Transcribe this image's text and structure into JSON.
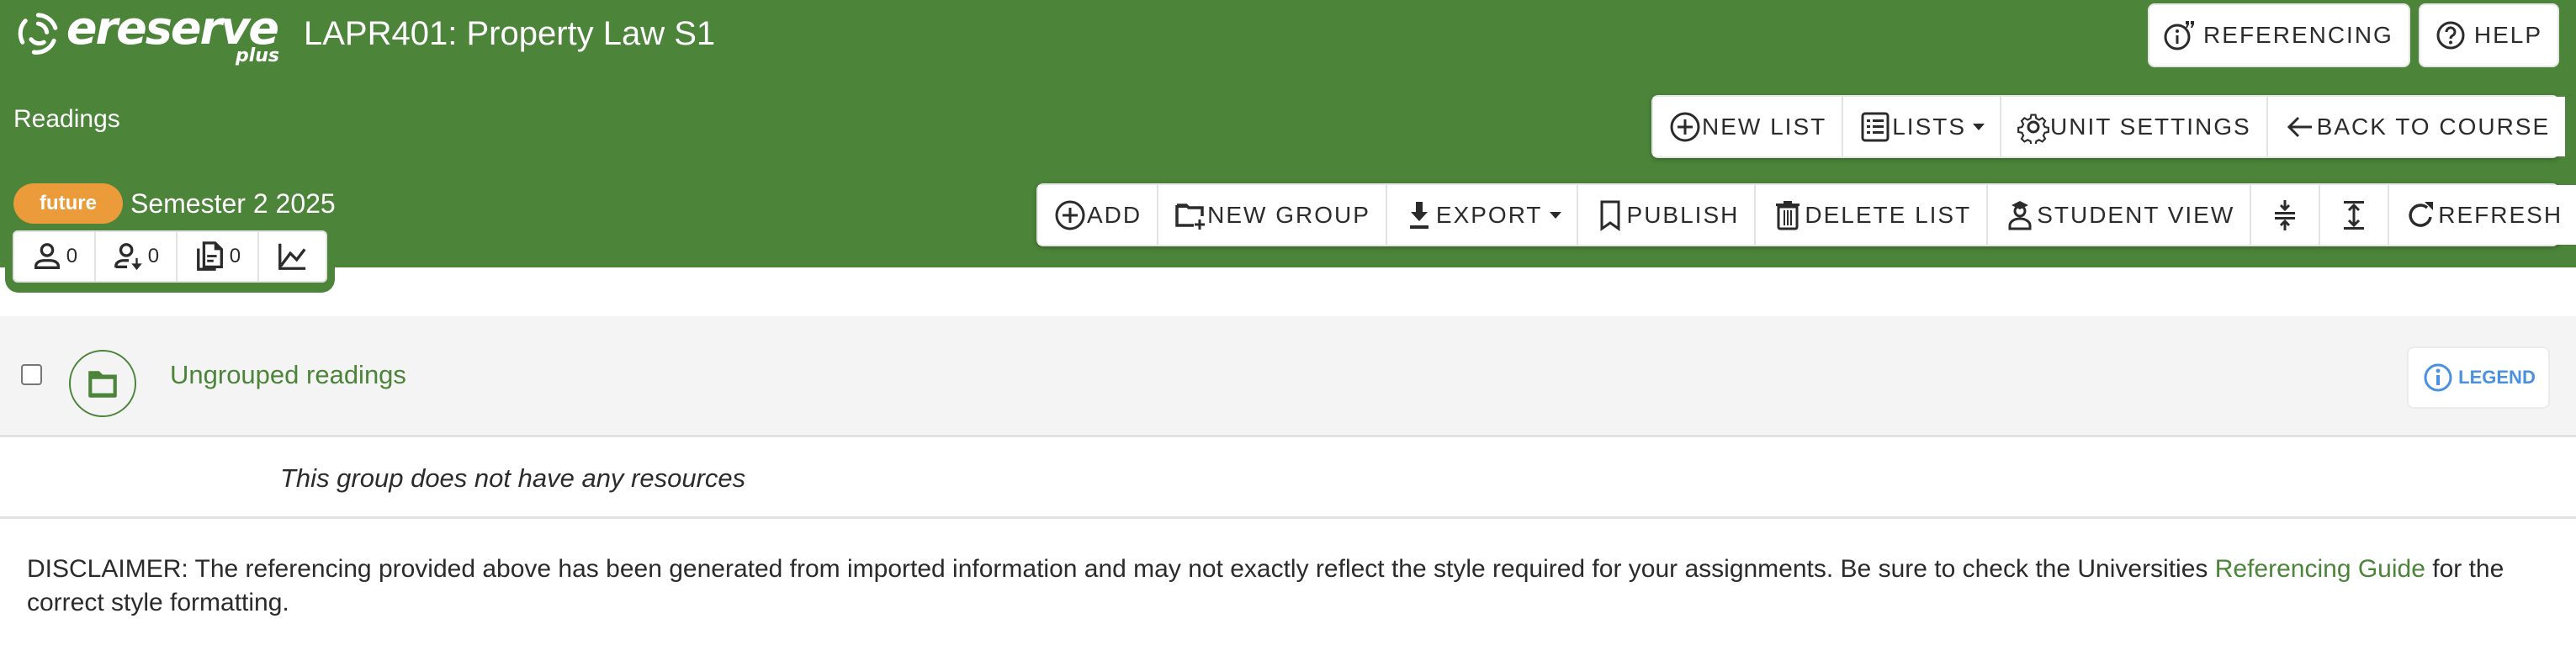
{
  "brand": {
    "name": "ereserve",
    "suffix": "plus",
    "color": "#4c843a"
  },
  "header": {
    "course_title": "LAPR401: Property Law S1",
    "section_title": "Readings",
    "status_badge": "future",
    "status_badge_color": "#eb9b3a",
    "semester": "Semester 2 2025",
    "top_buttons": {
      "referencing": "REFERENCING",
      "help": "HELP"
    }
  },
  "stats": {
    "students": "0",
    "students_imported": "0",
    "resources": "0",
    "analytics_icon": "line-chart-icon"
  },
  "toolbar1": {
    "new_list": "NEW LIST",
    "lists": "LISTS",
    "unit_settings": "UNIT SETTINGS",
    "back_to_course": "BACK TO COURSE"
  },
  "toolbar2": {
    "add": "ADD",
    "new_group": "NEW GROUP",
    "export": "EXPORT",
    "publish": "PUBLISH",
    "delete_list": "DELETE LIST",
    "student_view": "STUDENT VIEW",
    "collapse_icon": "collapse-all-icon",
    "expand_icon": "expand-all-icon",
    "refresh": "REFRESH"
  },
  "group": {
    "title": "Ungrouped readings",
    "legend": "LEGEND",
    "legend_color": "#4a90e2",
    "empty_message": "This group does not have any resources"
  },
  "disclaimer": {
    "text_before": "DISCLAIMER: The referencing provided above has been generated from imported information and may not exactly reflect the style required for your assignments. Be sure to check the Universities ",
    "link_text": "Referencing Guide",
    "text_after": " for the correct style formatting."
  }
}
